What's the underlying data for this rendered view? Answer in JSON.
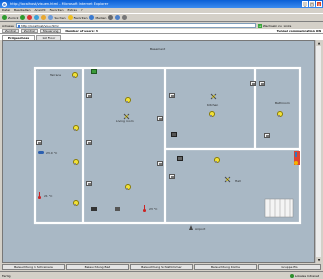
{
  "window": {
    "title": "http://localhost/visuen.html - Microsoft Internet Explorer",
    "ie_glyph": "e",
    "minimize": "_",
    "maximize": "□",
    "close": "x"
  },
  "menu": [
    "Datei",
    "Bearbeiten",
    "Ansicht",
    "Favoriten",
    "Extras",
    "?"
  ],
  "toolbar": {
    "back": "Zurück",
    "search": "Suchen",
    "favorites": "Favoriten",
    "media": "Medien"
  },
  "address": {
    "label": "Adresse",
    "value": "http://localhost/visu.html",
    "go": "Wechseln zu",
    "go_glyph": "→",
    "links": "Links"
  },
  "app": {
    "buttons": [
      "Zentral",
      "Zentral",
      "Steuerung"
    ],
    "registered_users": "Number of users: 3",
    "firewall": "Tunnel communication ON"
  },
  "tabs": [
    "Erdgeschoss",
    "1st Floor"
  ],
  "floorplan": {
    "rooms": {
      "basement": "Basement",
      "terrace": "Terrace",
      "living_room": "Living room",
      "kitchen": "Kitchen",
      "bathroom": "Bathroom",
      "hall": "Hall",
      "airport": "Airport"
    },
    "temperatures": {
      "terrace_sensor": "23.0 °C",
      "left_temp": "21 °C",
      "living_temp": "23 °C"
    }
  },
  "scroll": {
    "up": "▲",
    "down": "▼"
  },
  "bottom_buttons": [
    "Beleuchtung 1 Schreinere",
    "Beleuchtung Bad",
    "Beleuchtung Schlafzimmer",
    "Beleuchtung Küche",
    "Gruppe EG"
  ],
  "status": {
    "left": "Fertig",
    "zone": "Lokales Intranet"
  },
  "colors": {
    "floor": "#a9b8c5",
    "wall": "#ffffff",
    "title_bar": "#0a5fd6",
    "bulb": "#f2e23a"
  }
}
